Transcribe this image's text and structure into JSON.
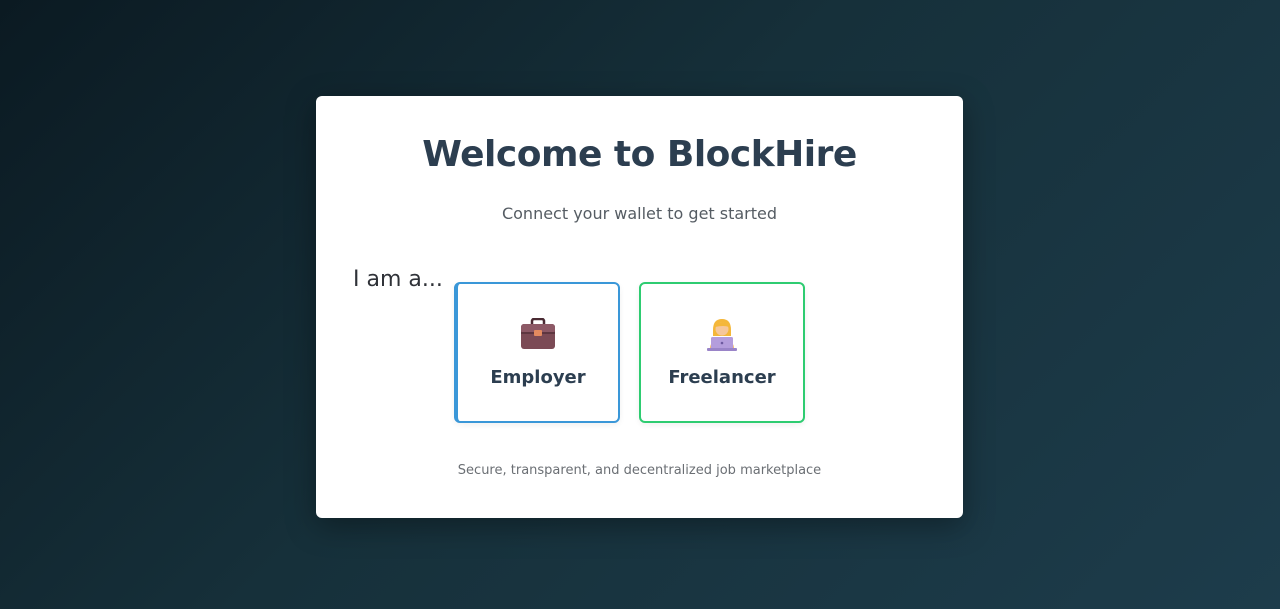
{
  "card": {
    "title": "Welcome to BlockHire",
    "subtitle": "Connect your wallet to get started",
    "role_prompt": "I am a...",
    "roles": [
      {
        "label": "Employer",
        "icon": "briefcase-icon",
        "accent": "#3a97d8"
      },
      {
        "label": "Freelancer",
        "icon": "person-laptop-icon",
        "accent": "#2ecc71"
      }
    ],
    "footer": "Secure, transparent, and decentralized job marketplace"
  }
}
